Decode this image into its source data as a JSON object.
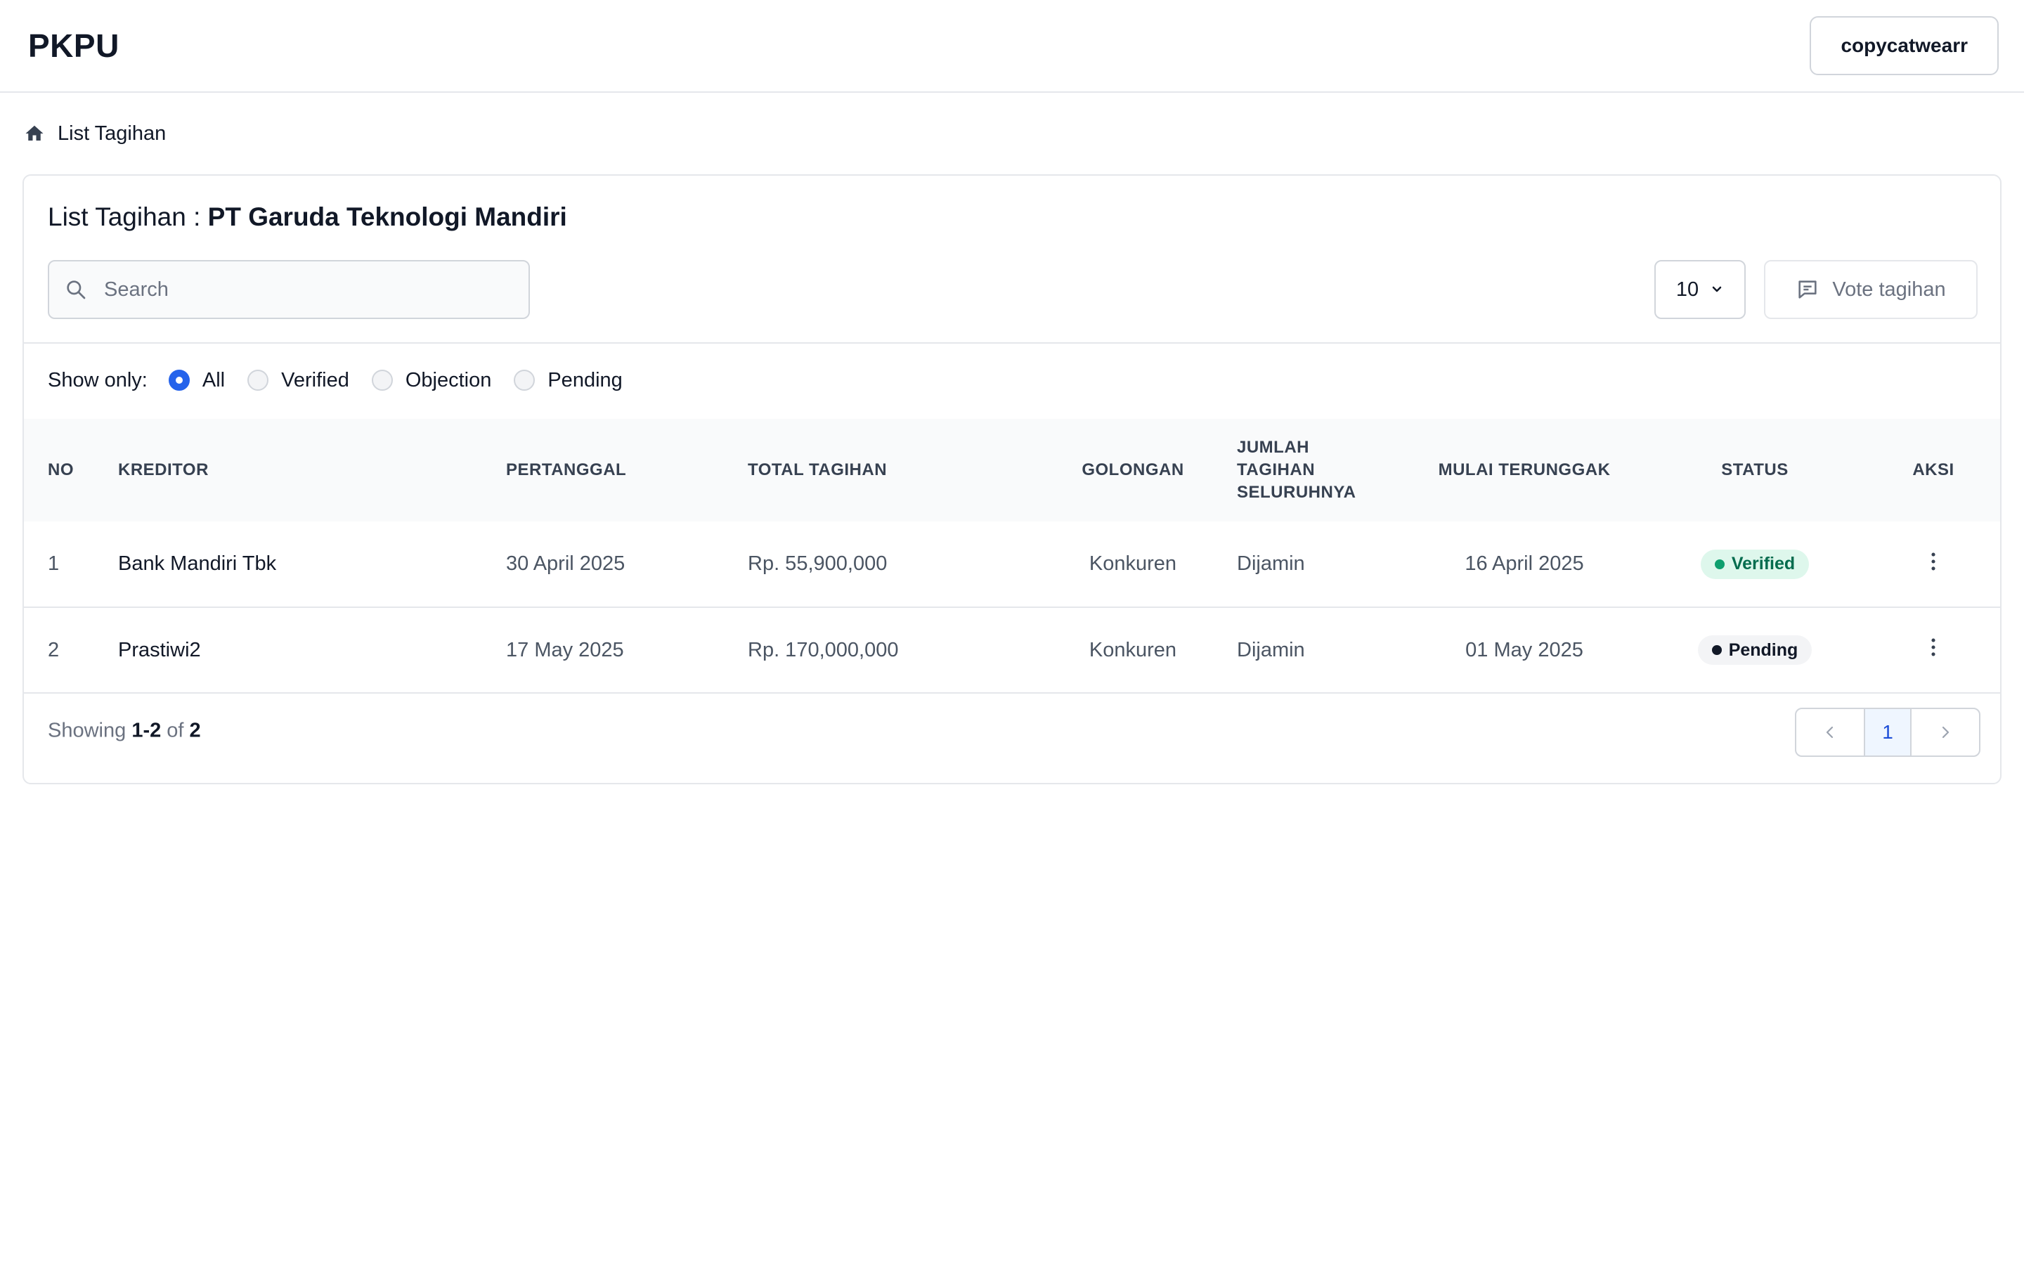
{
  "app": {
    "brand": "PKPU",
    "user": "copycatwearr"
  },
  "breadcrumb": {
    "label": "List Tagihan"
  },
  "card": {
    "title_prefix": "List Tagihan : ",
    "title_company": "PT Garuda Teknologi Mandiri",
    "search_placeholder": "Search",
    "per_page": "10",
    "vote_label": "Vote tagihan"
  },
  "filters": {
    "label": "Show only:",
    "options": [
      "All",
      "Verified",
      "Objection",
      "Pending"
    ],
    "selected": "All"
  },
  "table": {
    "headers": [
      "NO",
      "KREDITOR",
      "PERTANGGAL",
      "TOTAL TAGIHAN",
      "GOLONGAN",
      "JUMLAH TAGIHAN SELURUHNYA",
      "MULAI TERUNGGAK",
      "STATUS",
      "AKSI"
    ],
    "header_jumlah_lines": [
      "JUMLAH",
      "TAGIHAN",
      "SELURUHNYA"
    ],
    "rows": [
      {
        "no": "1",
        "kreditor": "Bank Mandiri Tbk",
        "pertanggal": "30 April 2025",
        "total": "Rp. 55,900,000",
        "golongan": "Konkuren",
        "jumlah": "Dijamin",
        "mulai": "16 April 2025",
        "status": "Verified"
      },
      {
        "no": "2",
        "kreditor": "Prastiwi2",
        "pertanggal": "17 May 2025",
        "total": "Rp. 170,000,000",
        "golongan": "Konkuren",
        "jumlah": "Dijamin",
        "mulai": "01 May 2025",
        "status": "Pending"
      }
    ]
  },
  "footer": {
    "showing": "Showing",
    "range": "1-2",
    "of": "of",
    "total": "2",
    "current_page": "1"
  },
  "colors": {
    "verified": "#0e9f6e",
    "accent": "#2563eb"
  }
}
